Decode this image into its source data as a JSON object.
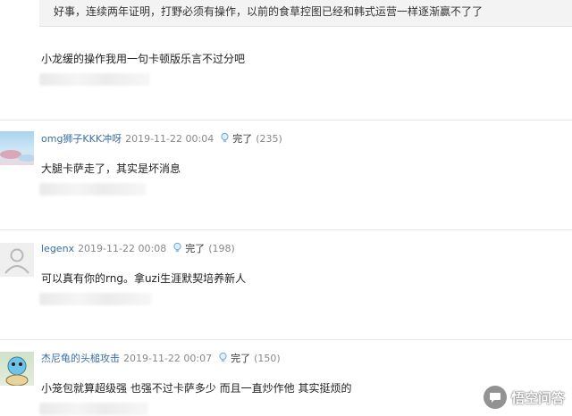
{
  "quote": {
    "text": "好事，连续两年证明，打野必须有操作，以前的食草控图已经和韩式运营一样逐渐赢不了了"
  },
  "comment0": {
    "text": "小龙缓的操作我用一句卡顿版乐言不过分吧"
  },
  "comments": [
    {
      "user": "omg狮子KKK冲呀",
      "date": "2019-11-22 00:04",
      "like_label": "完了",
      "like_count": "(235)",
      "text": "大腿卡萨走了，其实是坏消息"
    },
    {
      "user": "legenx",
      "date": "2019-11-22 00:08",
      "like_label": "完了",
      "like_count": "(198)",
      "text": "可以真有你的rng。拿uzi生涯默契培养新人"
    },
    {
      "user": "杰尼龟的头槌攻击",
      "date": "2019-11-22 00:07",
      "like_label": "完了",
      "like_count": "(150)",
      "text": "小笼包就算超级强 也强不过卡萨多少 而且一直炒作他 其实挺烦的"
    }
  ],
  "icons": {
    "like": "lightbulb-icon",
    "avatar_default": "default-avatar-icon",
    "watermark": "chat-bubble-icon"
  },
  "watermark": {
    "text": "悟空问答"
  },
  "colors": {
    "username": "#3a6ea5",
    "meta": "#888888",
    "quote_bg": "#f3f3f3"
  }
}
